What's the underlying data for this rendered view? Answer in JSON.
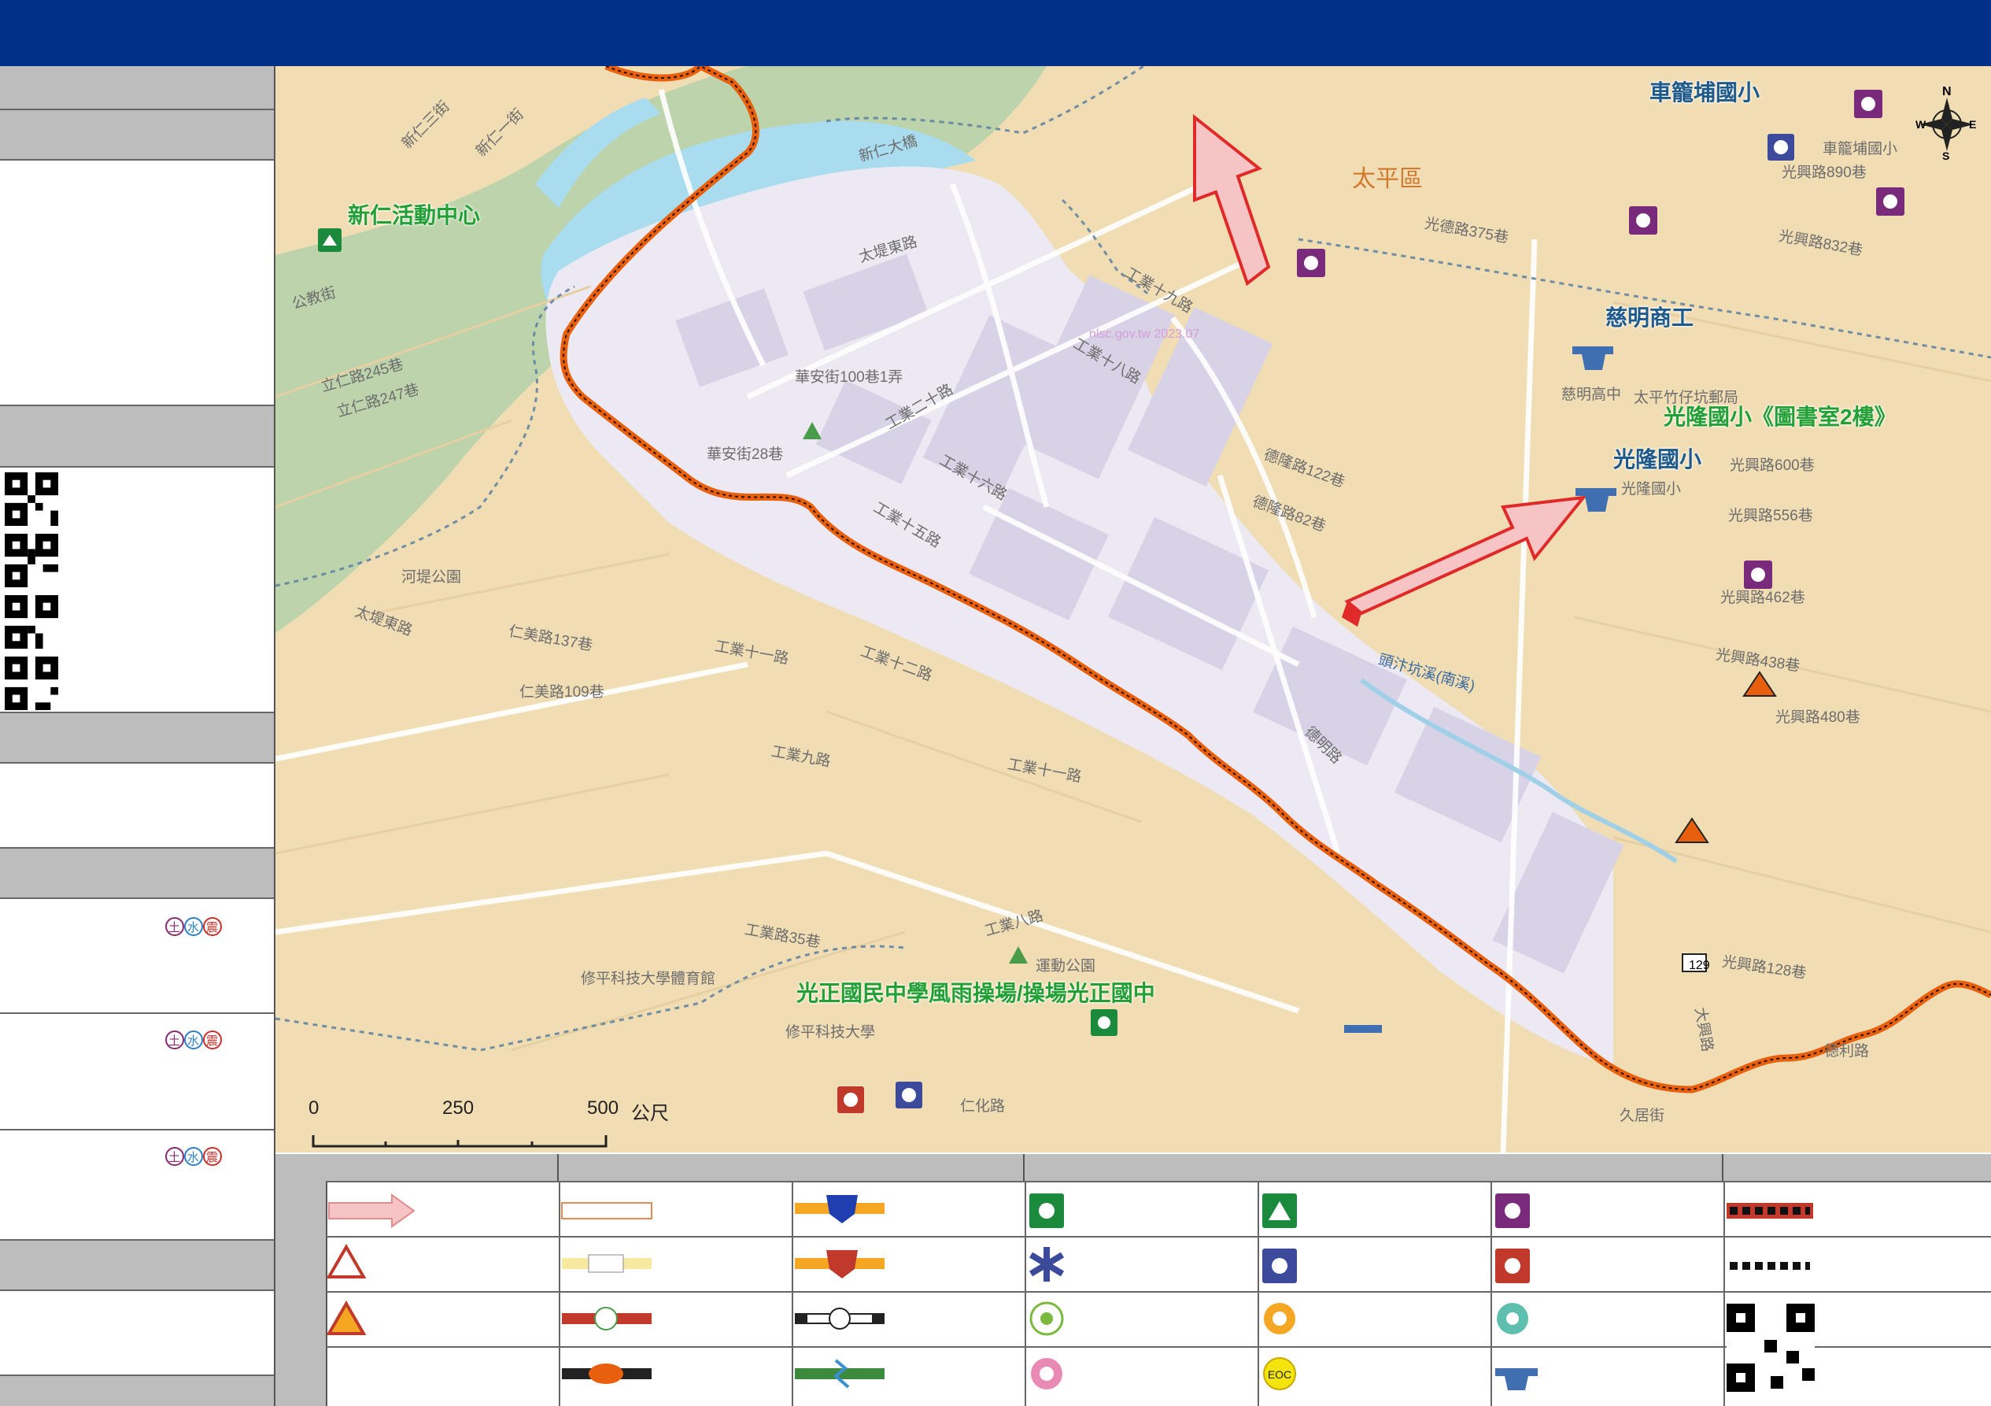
{
  "colors": {
    "header_bg": "#003087",
    "panel_grey": "#bdbdbd",
    "river": "#a9dcef",
    "zone": "#ece9f3",
    "boundary": "#e8600e",
    "evac_arrow": "#e02a2a",
    "facility_green": "#22a035",
    "facility_blue": "#1e5a8c",
    "district": "#d07a30"
  },
  "map": {
    "district_label": "太平區",
    "facilities": [
      {
        "name": "新仁活動中心",
        "color": "green"
      },
      {
        "name": "車籠埔國小",
        "color": "blue"
      },
      {
        "name": "慈明商工",
        "color": "blue"
      },
      {
        "name": "光隆國小《圖書室2樓》",
        "color": "green"
      },
      {
        "name": "光隆國小",
        "color": "blue"
      },
      {
        "name": "光正國民中學風雨操場/操場光正國中",
        "color": "green"
      }
    ],
    "streets": [
      "太堤東路",
      "太堤東路",
      "新仁大橋",
      "工業十九路",
      "工業十八路",
      "工業二十路",
      "工業十六路",
      "工業十五路",
      "華安街100巷1弄",
      "華安街28巷",
      "仁美路137巷",
      "仁美路109巷",
      "工業十一路",
      "工業十二路",
      "工業九路",
      "工業十一路",
      "工業八路",
      "工業路35巷",
      "仁化路",
      "光興路600巷",
      "光興路556巷",
      "光興路462巷",
      "光興路438巷",
      "光興路480巷",
      "光德路375巷",
      "光興路890巷",
      "光興路832巷",
      "德隆路122巷",
      "德隆路82巷",
      "德明路",
      "光興路128巷",
      "德利路",
      "久居街",
      "河堤公園",
      "修平科技大學",
      "修平科技大學體育館",
      "運動公園",
      "太平竹仔坑郵局",
      "慈明高中",
      "光隆國小",
      "車籠埔國小",
      "立仁路245巷",
      "立仁路247巷",
      "公教街",
      "新仁一街",
      "新仁三街",
      "大興路",
      "頭汴坑溪(南溪)",
      "nlsc.gov.tw 2023.07"
    ],
    "road_badge": "129",
    "compass": {
      "n": "N",
      "e": "E",
      "s": "S",
      "w": "W"
    },
    "scale": {
      "t0": "0",
      "t1": "250",
      "t2": "500",
      "unit": "公尺"
    }
  },
  "sidebar": {
    "hazard_tags": [
      "土",
      "水",
      "震"
    ]
  },
  "legend": {
    "icons": [
      "evacuation-direction-arrow",
      "landslide-warning-icon",
      "rockfall-warning-icon",
      "evacuation-route-line-icon",
      "road-line-icon",
      "park-line-icon",
      "bus-route-icon",
      "police-station-icon",
      "fire-station-icon",
      "railway-line-icon",
      "transit-line-icon",
      "emergency-shelter-icon",
      "medical-icon",
      "wheelchair-accessible-icon",
      "aid-station-icon",
      "indoor-shelter-icon",
      "police-agency-icon",
      "elderly-care-icon",
      "eoc-icon",
      "shelter-building-icon",
      "fire-agency-icon",
      "child-care-icon",
      "helicopter-landing-icon",
      "red-dashed-boundary-icon",
      "black-dashed-boundary-icon",
      "qr-code-icon"
    ]
  }
}
